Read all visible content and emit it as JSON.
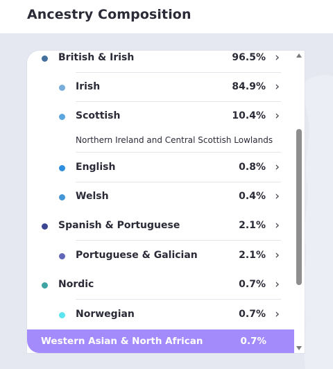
{
  "header": {
    "title": "Ancestry Composition"
  },
  "colors": {
    "british_irish": "#44709f",
    "irish": "#79aedb",
    "scottish": "#5ca6df",
    "english": "#2f8fdf",
    "welsh": "#4496d6",
    "spanish_portuguese": "#3b4591",
    "portuguese_galician": "#6067b8",
    "nordic": "#3ea3a3",
    "norwegian": "#5ae5ef",
    "highlight": "#a48bfb"
  },
  "rows": [
    {
      "name": "British & Irish",
      "pct": "96.5%"
    },
    {
      "name": "Irish",
      "pct": "84.9%"
    },
    {
      "name": "Scottish",
      "pct": "10.4%",
      "note": "Northern Ireland and Central Scottish Lowlands"
    },
    {
      "name": "English",
      "pct": "0.8%"
    },
    {
      "name": "Welsh",
      "pct": "0.4%"
    },
    {
      "name": "Spanish & Portuguese",
      "pct": "2.1%"
    },
    {
      "name": "Portuguese & Galician",
      "pct": "2.1%"
    },
    {
      "name": "Nordic",
      "pct": "0.7%"
    },
    {
      "name": "Norwegian",
      "pct": "0.7%"
    },
    {
      "name": "Western Asian & North African",
      "pct": "0.7%"
    }
  ],
  "chevron": "›"
}
